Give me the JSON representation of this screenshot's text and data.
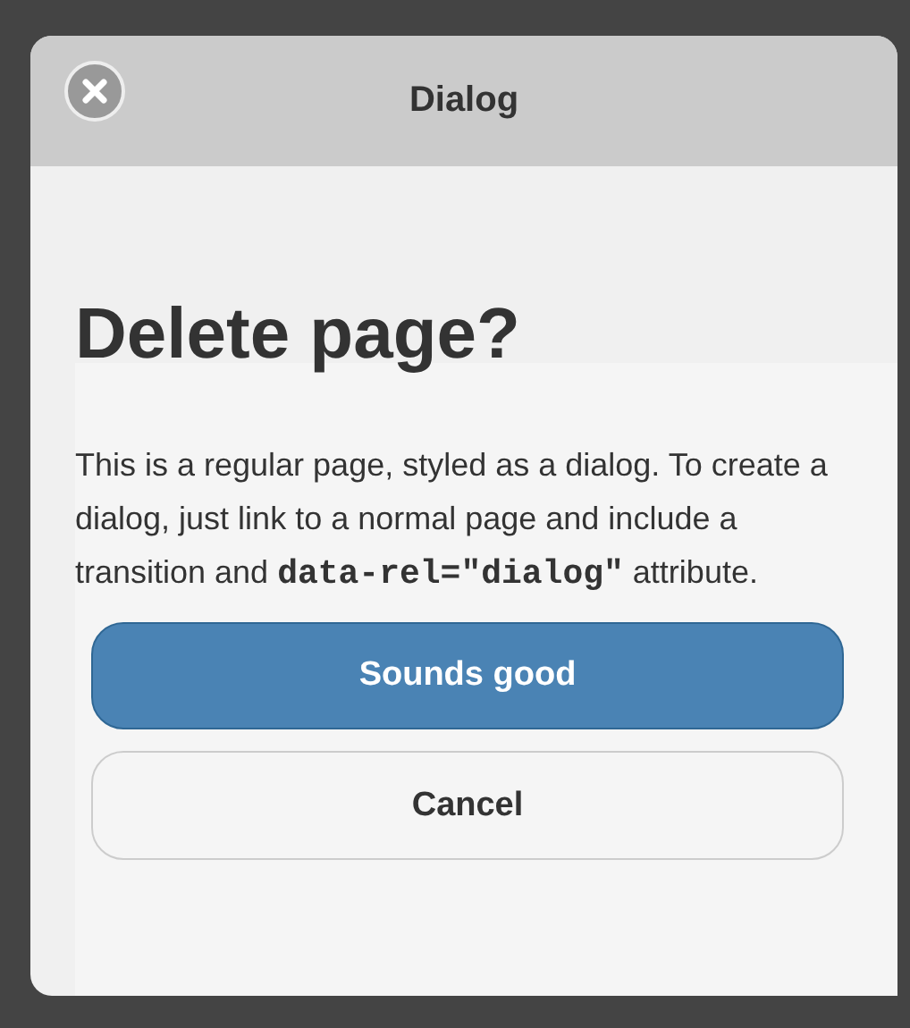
{
  "header": {
    "title": "Dialog"
  },
  "content": {
    "heading": "Delete page?",
    "paragraph": "This is a regular page, styled as a dialog. To create a dialog, just link to a normal page and include a transition and **data-rel=\"dialog\"** attribute."
  },
  "buttons": [
    {
      "label": "Sounds good",
      "kind": "primary"
    },
    {
      "label": "Cancel",
      "kind": "default"
    }
  ]
}
